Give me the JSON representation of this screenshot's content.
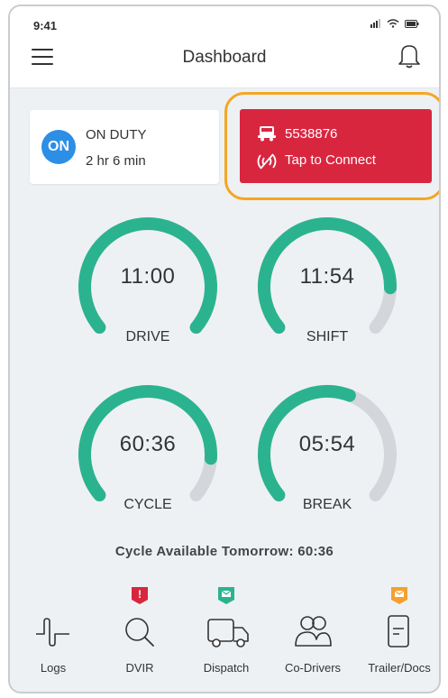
{
  "status_bar": {
    "time": "9:41"
  },
  "header": {
    "title": "Dashboard"
  },
  "duty": {
    "badge": "ON",
    "status": "ON DUTY",
    "elapsed": "2 hr 6 min"
  },
  "connect": {
    "vehicle_id": "5538876",
    "label": "Tap to Connect",
    "color": "#d9263f",
    "highlight": "#f5a623"
  },
  "gauges": [
    {
      "id": "drive",
      "value": "11:00",
      "label": "DRIVE",
      "fill": 1.0
    },
    {
      "id": "shift",
      "value": "11:54",
      "label": "SHIFT",
      "fill": 0.85
    },
    {
      "id": "cycle",
      "value": "60:36",
      "label": "CYCLE",
      "fill": 0.86
    },
    {
      "id": "break",
      "value": "05:54",
      "label": "BREAK",
      "fill": 0.58
    }
  ],
  "gauge_colors": {
    "fill": "#2bb390",
    "track": "#d3d6da"
  },
  "cycle_available": "Cycle Available Tomorrow: 60:36",
  "nav": [
    {
      "label": "Logs",
      "icon": "logs-icon",
      "badge": null
    },
    {
      "label": "DVIR",
      "icon": "search-icon",
      "badge": "!",
      "badge_color": "#d9263f"
    },
    {
      "label": "Dispatch",
      "icon": "truck-icon",
      "badge": "mail",
      "badge_color": "#2bb390"
    },
    {
      "label": "Co-Drivers",
      "icon": "users-icon",
      "badge": null
    },
    {
      "label": "Trailer/Docs",
      "icon": "document-icon",
      "badge": "mail",
      "badge_color": "#f5a030"
    }
  ]
}
